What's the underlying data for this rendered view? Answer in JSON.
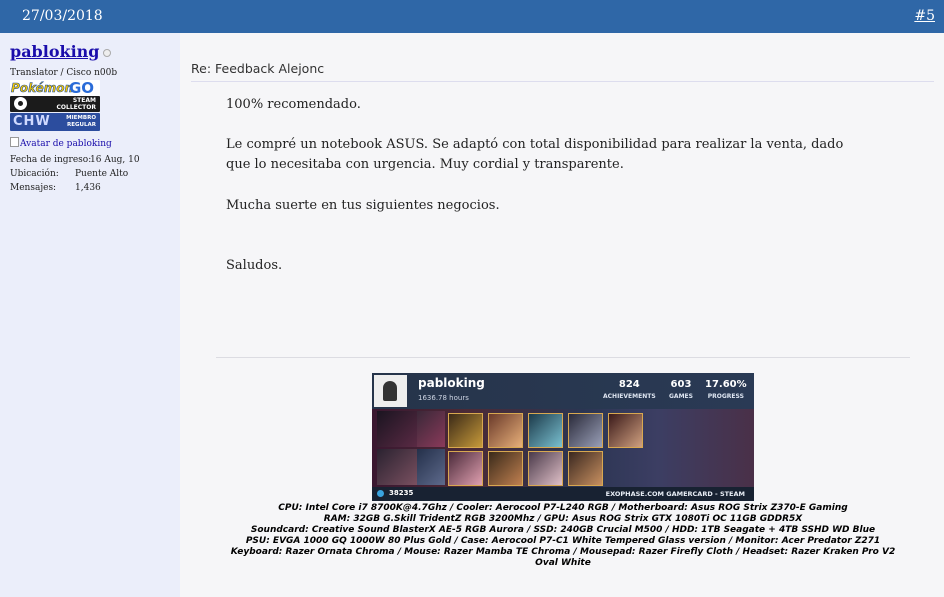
{
  "post_header": {
    "date": "27/03/2018",
    "post_number": "#5"
  },
  "user": {
    "username": "pabloking",
    "title": "Translator / Cisco n00b",
    "badges": {
      "pokemon": "Pokémon",
      "go": "GO",
      "steam_line1": "STEAM",
      "steam_line2": "COLLECTOR",
      "chw": "CHW",
      "chw_line1": "MIEMBRO",
      "chw_line2": "REGULAR"
    },
    "avatar_alt": "Avatar de pabloking",
    "info": [
      {
        "label": "Fecha de ingreso:",
        "value": "16 Aug, 10"
      },
      {
        "label": "Ubicación:",
        "value": "Puente Alto"
      },
      {
        "label": "Mensajes:",
        "value": "1,436"
      }
    ]
  },
  "post": {
    "title": "Re: Feedback Alejonc",
    "paragraphs": [
      "100% recomendado.",
      "Le compré un notebook ASUS. Se adaptó con total disponibilidad para realizar la venta, dado que lo necesitaba con urgencia. Muy cordial y transparente.",
      "Mucha suerte en tus siguientes negocios.",
      "Saludos."
    ]
  },
  "gamecard": {
    "username": "pabloking",
    "hours": "1636.78 hours",
    "achievements_value": "824",
    "achievements_label": "ACHIEVEMENTS",
    "games_value": "603",
    "games_label": "GAMES",
    "progress_value": "17.60%",
    "progress_label": "PROGRESS",
    "level": "38235",
    "brand": "EXOPHASE.COM GAMERCARD - STEAM"
  },
  "signature": {
    "lines": [
      "CPU: Intel Core i7 8700K@4.7Ghz / Cooler: Aerocool P7-L240 RGB / Motherboard: Asus ROG Strix Z370-E Gaming",
      "RAM: 32GB G.Skill TridentZ RGB 3200Mhz / GPU: Asus ROG Strix GTX 1080Ti OC 11GB GDDR5X",
      "Soundcard: Creative Sound BlasterX AE-5 RGB Aurora / SSD: 240GB Crucial M500 / HDD: 1TB Seagate + 4TB SSHD WD Blue",
      "PSU: EVGA 1000 GQ 1000W 80 Plus Gold / Case: Aerocool P7-C1 White Tempered Glass version / Monitor: Acer Predator Z271",
      "Keyboard: Razer Ornata Chroma / Mouse: Razer Mamba TE Chroma / Mousepad: Razer Firefly Cloth / Headset: Razer Kraken Pro V2",
      "Oval White"
    ]
  },
  "colors": {
    "header_bg": "#2f67a7",
    "sidebar_bg": "#ebeefa",
    "link": "#1a0dab"
  }
}
